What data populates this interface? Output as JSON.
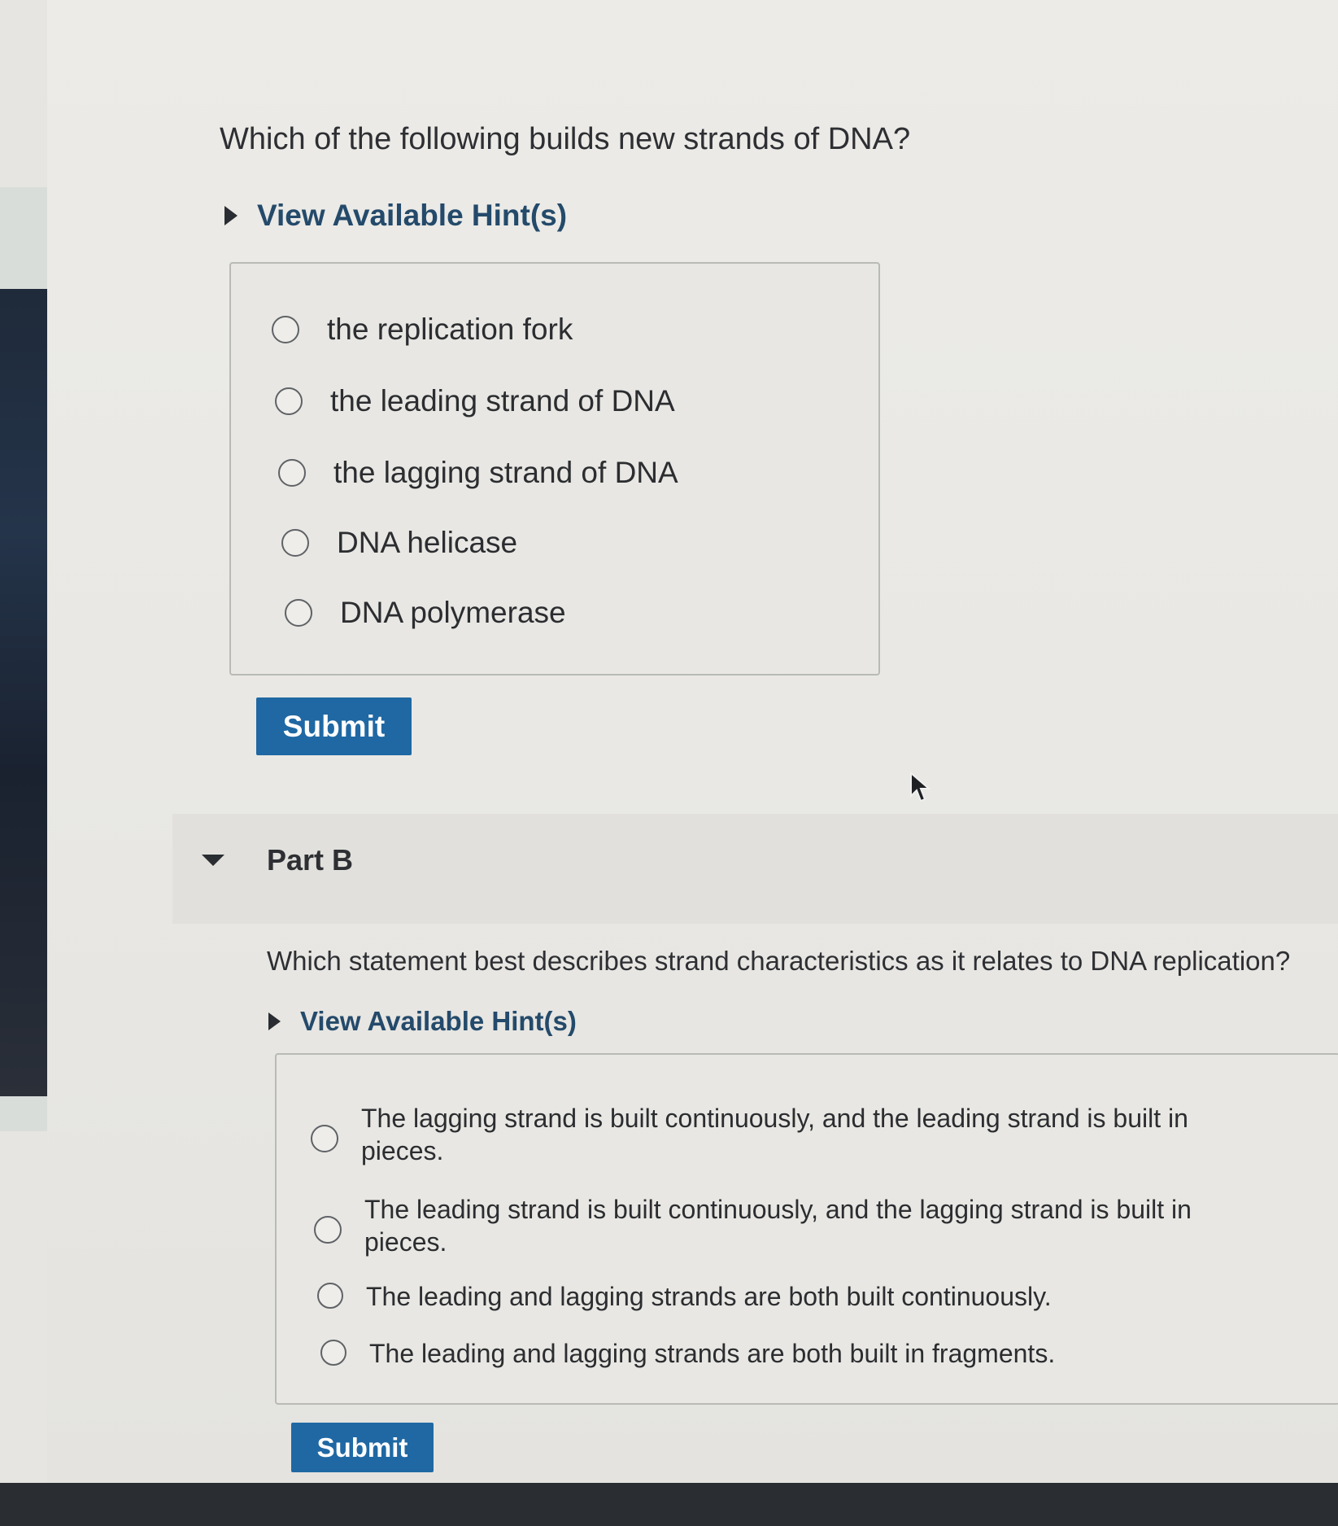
{
  "part_a": {
    "question": "Which of the following builds new strands of DNA?",
    "hint_label": "View Available Hint(s)",
    "options": [
      "the replication fork",
      "the leading strand of DNA",
      "the lagging strand of DNA",
      "DNA helicase",
      "DNA polymerase"
    ],
    "submit_label": "Submit"
  },
  "part_b": {
    "title": "Part B",
    "question": "Which statement best describes strand characteristics as it relates to DNA replication?",
    "hint_label": "View Available Hint(s)",
    "options": [
      "The lagging strand is built continuously, and the leading strand is built in pieces.",
      "The leading strand is built continuously, and the lagging strand is built in pieces.",
      "The leading and lagging strands are both built continuously.",
      "The leading and lagging strands are both built in fragments."
    ],
    "submit_label": "Submit"
  },
  "colors": {
    "accent": "#1f68a3",
    "hint_text": "#244a6b"
  }
}
